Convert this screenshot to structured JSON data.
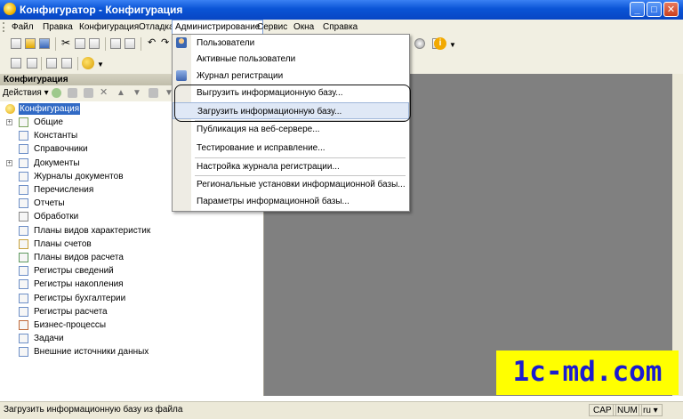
{
  "window": {
    "title": "Конфигуратор - Конфигурация",
    "minimize": "_",
    "maximize": "□",
    "close": "✕"
  },
  "menubar": {
    "items": [
      "Файл",
      "Правка",
      "Конфигурация",
      "Отладка",
      "Администрирование",
      "Сервис",
      "Окна",
      "Справка"
    ]
  },
  "admin_menu": {
    "items": [
      {
        "label": "Пользователи",
        "icon": "users-icon"
      },
      {
        "label": "Активные пользователи",
        "icon": ""
      },
      {
        "label": "Журнал регистрации",
        "icon": "log-icon"
      },
      {
        "label": "Выгрузить информационную базу...",
        "icon": ""
      },
      {
        "label": "Загрузить информационную базу...",
        "icon": ""
      },
      {
        "label": "Публикация на веб-сервере...",
        "icon": ""
      },
      {
        "label": "Тестирование и исправление...",
        "icon": ""
      },
      {
        "label": "Настройка журнала регистрации...",
        "icon": ""
      },
      {
        "label": "Региональные установки информационной базы...",
        "icon": ""
      },
      {
        "label": "Параметры информационной базы...",
        "icon": ""
      }
    ],
    "highlighted_index": 4
  },
  "panel": {
    "title": "Конфигурация",
    "actions_label": "Действия ▾"
  },
  "tree": {
    "root": "Конфигурация",
    "items": [
      {
        "label": "Общие",
        "expandable": true
      },
      {
        "label": "Константы",
        "expandable": false
      },
      {
        "label": "Справочники",
        "expandable": false
      },
      {
        "label": "Документы",
        "expandable": true
      },
      {
        "label": "Журналы документов",
        "expandable": false
      },
      {
        "label": "Перечисления",
        "expandable": false
      },
      {
        "label": "Отчеты",
        "expandable": false
      },
      {
        "label": "Обработки",
        "expandable": false
      },
      {
        "label": "Планы видов характеристик",
        "expandable": false
      },
      {
        "label": "Планы счетов",
        "expandable": false
      },
      {
        "label": "Планы видов расчета",
        "expandable": false
      },
      {
        "label": "Регистры сведений",
        "expandable": false
      },
      {
        "label": "Регистры накопления",
        "expandable": false
      },
      {
        "label": "Регистры бухгалтерии",
        "expandable": false
      },
      {
        "label": "Регистры расчета",
        "expandable": false
      },
      {
        "label": "Бизнес-процессы",
        "expandable": false
      },
      {
        "label": "Задачи",
        "expandable": false
      },
      {
        "label": "Внешние источники данных",
        "expandable": false
      }
    ]
  },
  "statusbar": {
    "text": "Загрузить информационную базу из файла",
    "cap": "CAP",
    "num": "NUM",
    "lang": "ru ▾"
  },
  "watermark": {
    "text": "1c-md.com"
  },
  "colors": {
    "title_bar": "#0a54d6",
    "selection": "#316ac5",
    "menu_highlight": "#dfe8f6",
    "watermark_bg": "#ffff00",
    "watermark_text": "#1a1bd0"
  }
}
